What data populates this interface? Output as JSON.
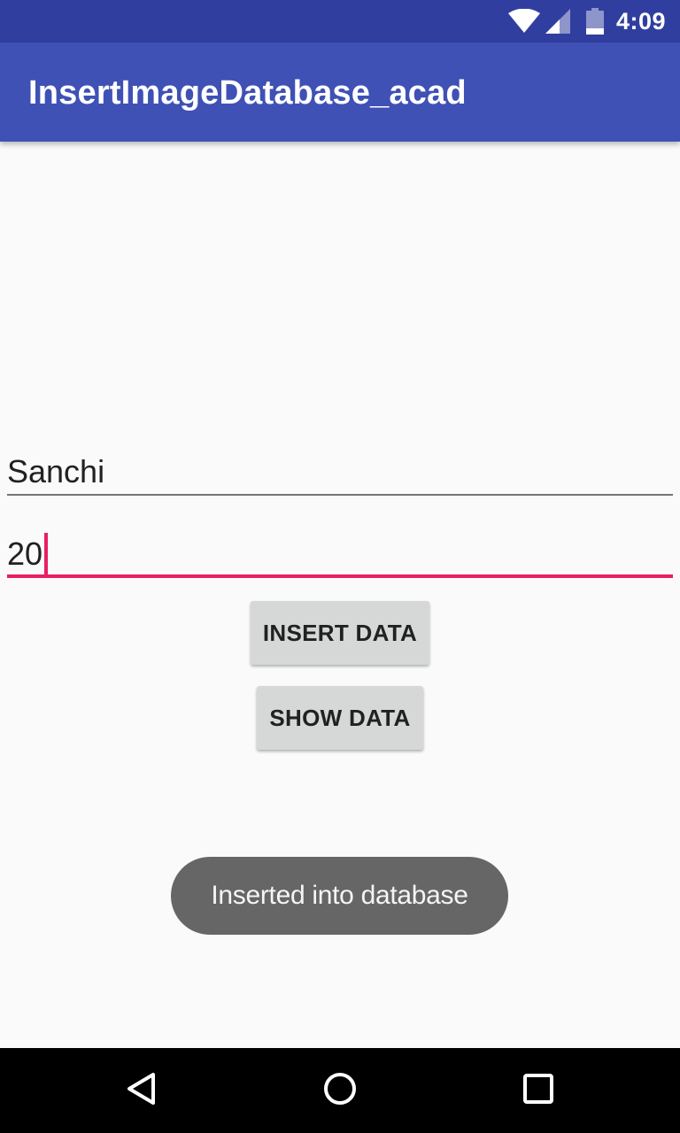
{
  "status_bar": {
    "time": "4:09",
    "icons": [
      "wifi-icon",
      "signal-icon",
      "battery-icon"
    ]
  },
  "app_bar": {
    "title": "InsertImageDatabase_acad"
  },
  "form": {
    "name_value": "Sanchi",
    "age_value": "20"
  },
  "buttons": {
    "insert_label": "INSERT DATA",
    "show_label": "SHOW DATA"
  },
  "toast": {
    "message": "Inserted into database"
  },
  "nav_bar": {
    "icons": [
      "back-icon",
      "home-icon",
      "recents-icon"
    ]
  },
  "colors": {
    "status_bar": "#303f9f",
    "app_bar": "#3f51b5",
    "accent": "#e91e63",
    "button": "#d6d7d7",
    "toast": "#666666"
  }
}
